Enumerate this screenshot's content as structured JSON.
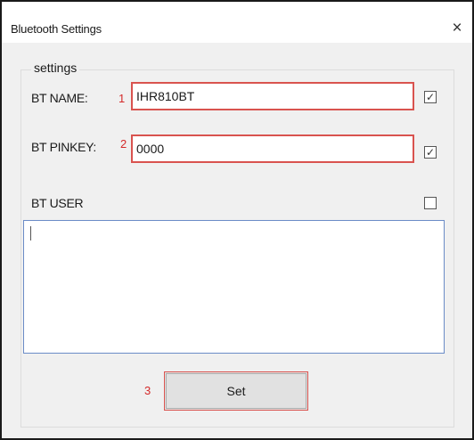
{
  "window": {
    "title": "Bluetooth Settings",
    "close_glyph": "×"
  },
  "group": {
    "legend": "settings"
  },
  "fields": {
    "bt_name": {
      "label": "BT NAME:",
      "marker": "1",
      "value": "IHR810BT",
      "checked": true
    },
    "bt_pinkey": {
      "label": "BT PINKEY:",
      "marker": "2",
      "value": "0000",
      "checked": true
    },
    "bt_user": {
      "label": "BT USER",
      "checked": false,
      "value": ""
    }
  },
  "set_button": {
    "label": "Set",
    "marker": "3"
  },
  "icons": {
    "check": "checkmark-icon",
    "close": "close-icon"
  },
  "colors": {
    "annotation_red": "#d42a2a",
    "textbox_highlight": "#d9534f",
    "multiline_border": "#6b8cc7",
    "dialog_bg": "#f0f0f0"
  }
}
